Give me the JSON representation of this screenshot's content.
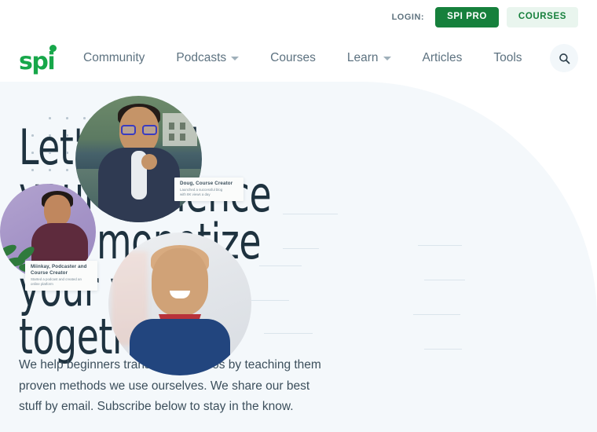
{
  "topbar": {
    "login_label": "LOGIN:",
    "pro_button": "SPI PRO",
    "courses_button": "COURSES"
  },
  "nav": {
    "logo_text": "spi",
    "logo_dot_icon": "logo-dot",
    "search_icon": "search-icon",
    "items": [
      {
        "label": "Community",
        "has_caret": false
      },
      {
        "label": "Podcasts",
        "has_caret": true
      },
      {
        "label": "Courses",
        "has_caret": false
      },
      {
        "label": "Learn",
        "has_caret": true
      },
      {
        "label": "Articles",
        "has_caret": false
      },
      {
        "label": "Tools",
        "has_caret": false
      }
    ]
  },
  "hero": {
    "headline": "Let's build your audience and monetize your work, together",
    "subcopy": "We help beginners transform into pros by teaching them proven methods we use ourselves. We share our best stuff by email. Subscribe below to stay in the know."
  },
  "testimonials": [
    {
      "id": "doug",
      "name": "Doug, Course Creator",
      "detail": "Launched a successful blog\nwith 8K views a day",
      "photo_alt": "doug-portrait"
    },
    {
      "id": "miinkay",
      "name": "Miinkay, Podcaster and\nCourse Creator",
      "detail": "Started a podcast and created an\nonline platform",
      "photo_alt": "miinkay-portrait"
    },
    {
      "id": "third",
      "name": "",
      "detail": "",
      "photo_alt": "third-portrait"
    }
  ],
  "colors": {
    "brand_green": "#17a74a",
    "pro_green": "#16803c",
    "courses_bg": "#e9f5ee",
    "hero_bg": "#f4f8fb",
    "headline": "#1e323f",
    "nav_text": "#5d7280",
    "body_text": "#3c4f5c"
  }
}
